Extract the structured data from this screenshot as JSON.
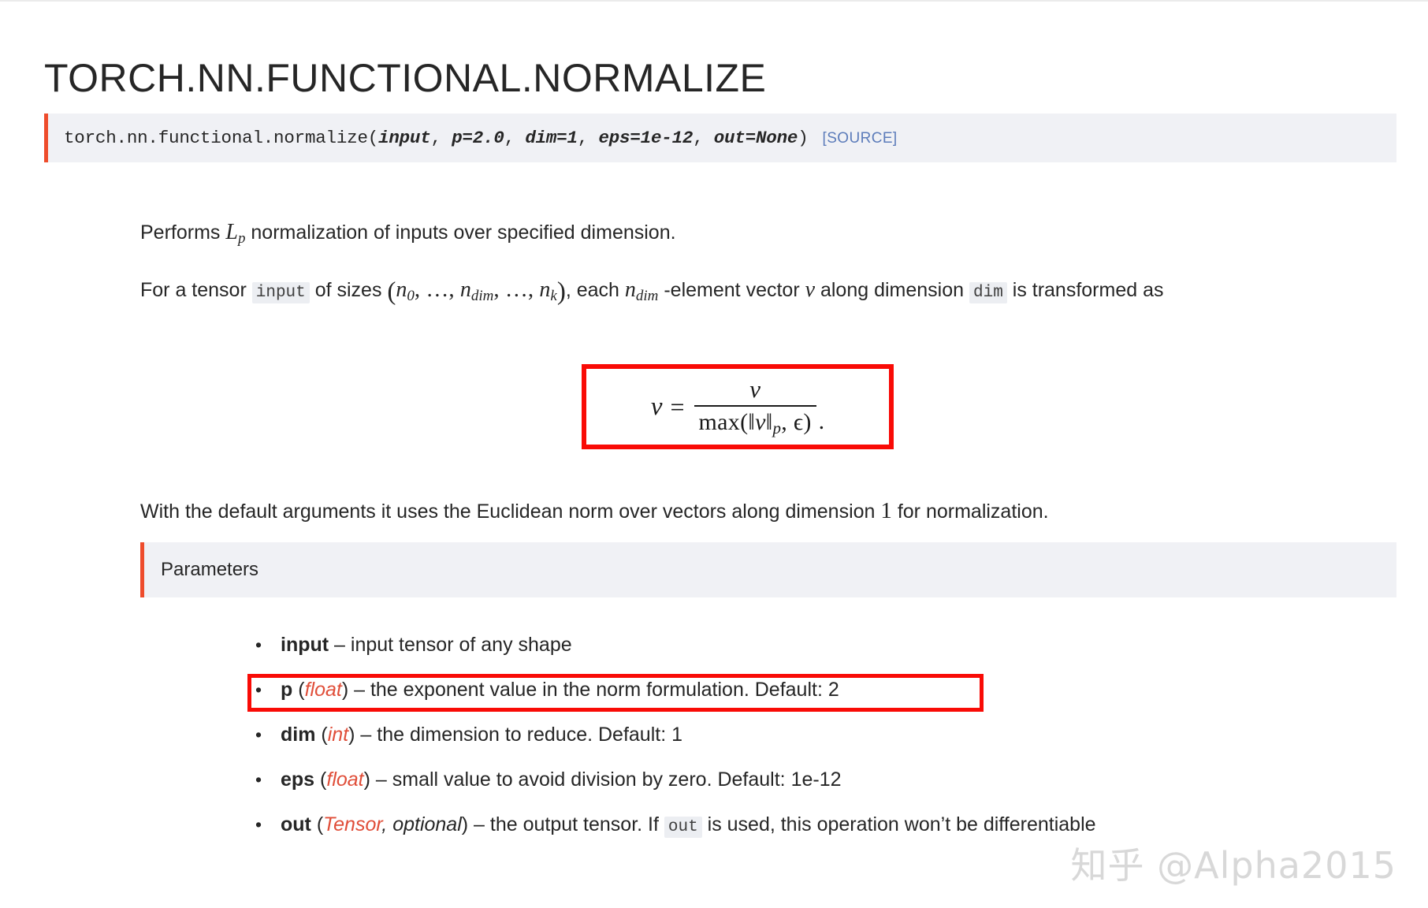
{
  "page": {
    "title": "TORCH.NN.FUNCTIONAL.NORMALIZE",
    "watermark": "知乎 @Alpha2015"
  },
  "signature": {
    "prefix": "torch.nn.functional.normalize(",
    "args": [
      {
        "text": "input"
      },
      {
        "text": "p=2.0"
      },
      {
        "text": "dim=1"
      },
      {
        "text": "eps=1e-12"
      },
      {
        "text": "out=None"
      }
    ],
    "suffix": ")",
    "source_label": "[SOURCE]",
    "accent_color": "#ee4c2c",
    "background_color": "#f0f1f5",
    "link_color": "#5c7cba"
  },
  "body": {
    "para1": {
      "before": "Performs ",
      "math": "L",
      "math_sub": "p",
      "after": " normalization of inputs over specified dimension."
    },
    "para2": {
      "t1": "For a tensor ",
      "code1": "input",
      "t2": " of sizes ",
      "sizes_open": "(",
      "n0": "n",
      "n0_sub": "0",
      "ellipsis1": ", …, ",
      "ndim": "n",
      "ndim_sub": "dim",
      "ellipsis2": ", …, ",
      "nk": "n",
      "nk_sub": "k",
      "sizes_close": ")",
      "t3": ", each ",
      "ndim2": "n",
      "ndim2_sub": "dim",
      "t4": " -element vector ",
      "v": "v",
      "t5": " along dimension ",
      "code2": "dim",
      "t6": " is transformed as"
    },
    "para3": {
      "t1": "With the default arguments it uses the Euclidean norm over vectors along dimension ",
      "num": "1",
      "t2": " for normalization."
    }
  },
  "formula": {
    "lhs": "v",
    "equals": "=",
    "numerator": "v",
    "denominator_prefix": "max(‖",
    "denominator_v": "v",
    "denominator_mid": "‖",
    "denominator_sub": "p",
    "denominator_suffix": ", ϵ)",
    "trailing": ".",
    "highlight_color": "#f90b06"
  },
  "parameters": {
    "header": "Parameters",
    "items": [
      {
        "name": "input",
        "type": "",
        "type_extra": "",
        "desc": " – input tensor of any shape",
        "highlighted": false
      },
      {
        "name": "p",
        "type": "float",
        "type_extra": "",
        "desc": " – the exponent value in the norm formulation. Default: 2",
        "highlighted": true
      },
      {
        "name": "dim",
        "type": "int",
        "type_extra": "",
        "desc": " – the dimension to reduce. Default: 1",
        "highlighted": false
      },
      {
        "name": "eps",
        "type": "float",
        "type_extra": "",
        "desc": " – small value to avoid division by zero. Default: 1e-12",
        "highlighted": false
      },
      {
        "name": "out",
        "type": "Tensor",
        "type_extra": ", optional",
        "desc_before_code": " – the output tensor. If ",
        "code": "out",
        "desc_after_code": " is used, this operation won’t be differentiable",
        "highlighted": false
      }
    ]
  }
}
